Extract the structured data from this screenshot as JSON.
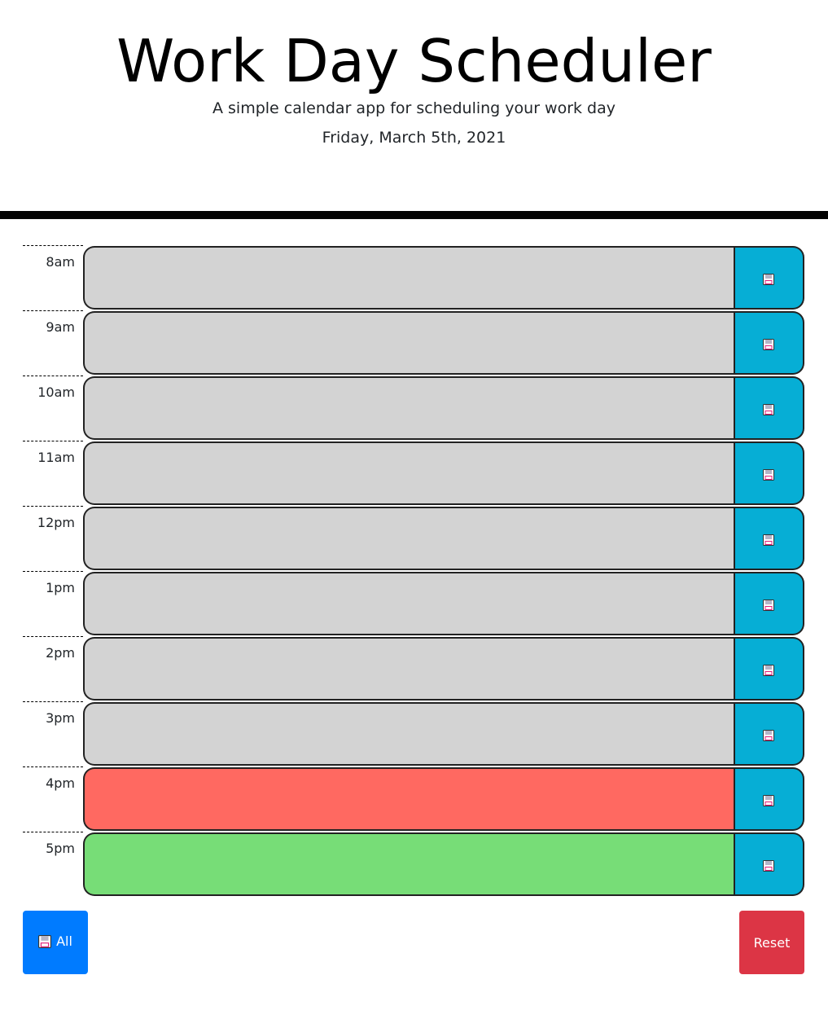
{
  "header": {
    "title": "Work Day Scheduler",
    "subtitle": "A simple calendar app for scheduling your work day",
    "date": "Friday, March 5th, 2021"
  },
  "rows": [
    {
      "hour": "8am",
      "status": "past",
      "text": ""
    },
    {
      "hour": "9am",
      "status": "past",
      "text": ""
    },
    {
      "hour": "10am",
      "status": "past",
      "text": ""
    },
    {
      "hour": "11am",
      "status": "past",
      "text": ""
    },
    {
      "hour": "12pm",
      "status": "past",
      "text": ""
    },
    {
      "hour": "1pm",
      "status": "past",
      "text": ""
    },
    {
      "hour": "2pm",
      "status": "past",
      "text": ""
    },
    {
      "hour": "3pm",
      "status": "past",
      "text": ""
    },
    {
      "hour": "4pm",
      "status": "present",
      "text": ""
    },
    {
      "hour": "5pm",
      "status": "future",
      "text": ""
    }
  ],
  "footer": {
    "save_all_label": "All",
    "save_all_icon": "floppy-disk-icon",
    "reset_label": "Reset"
  },
  "colors": {
    "past": "#d3d3d3",
    "present": "#ff6961",
    "future": "#77dd77",
    "save_button": "#06aed5",
    "save_all_button": "#007bff",
    "reset_button": "#dc3545"
  },
  "icons": {
    "row_save": "floppy-disk-icon"
  }
}
